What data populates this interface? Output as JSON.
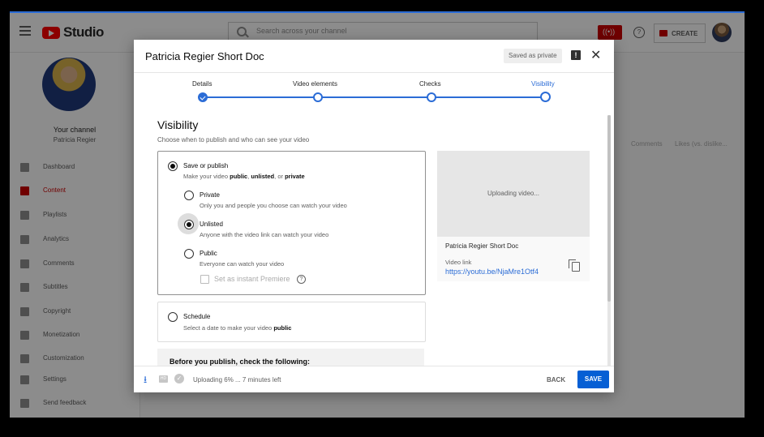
{
  "header": {
    "logo_text": "Studio",
    "search_placeholder": "Search across your channel",
    "create_label": "CREATE"
  },
  "sidebar": {
    "your_channel": "Your channel",
    "channel_name": "Patricia Regier",
    "items": [
      {
        "label": "Dashboard",
        "icon": "dashboard-icon"
      },
      {
        "label": "Content",
        "icon": "content-icon",
        "active": true
      },
      {
        "label": "Playlists",
        "icon": "playlists-icon"
      },
      {
        "label": "Analytics",
        "icon": "analytics-icon"
      },
      {
        "label": "Comments",
        "icon": "comments-icon"
      },
      {
        "label": "Subtitles",
        "icon": "subtitles-icon"
      },
      {
        "label": "Copyright",
        "icon": "copyright-icon"
      },
      {
        "label": "Monetization",
        "icon": "monetization-icon"
      },
      {
        "label": "Customization",
        "icon": "customization-icon"
      },
      {
        "label": "Settings",
        "icon": "settings-icon"
      },
      {
        "label": "Send feedback",
        "icon": "feedback-icon"
      }
    ]
  },
  "background": {
    "col_comments": "Comments",
    "col_likes": "Likes (vs. dislike..."
  },
  "dialog": {
    "title": "Patricia Regier Short Doc",
    "saved_badge": "Saved as private",
    "steps": [
      {
        "label": "Details",
        "state": "done"
      },
      {
        "label": "Video elements",
        "state": "pending"
      },
      {
        "label": "Checks",
        "state": "pending"
      },
      {
        "label": "Visibility",
        "state": "current"
      }
    ],
    "visibility_title": "Visibility",
    "visibility_sub": "Choose when to publish and who can see your video",
    "save_or_publish": {
      "label": "Save or publish",
      "desc_pre": "Make your video ",
      "desc_b1": "public",
      "desc_mid1": ", ",
      "desc_b2": "unlisted",
      "desc_mid2": ", or ",
      "desc_b3": "private"
    },
    "options": {
      "private_label": "Private",
      "private_desc": "Only you and people you choose can watch your video",
      "unlisted_label": "Unlisted",
      "unlisted_desc": "Anyone with the video link can watch your video",
      "public_label": "Public",
      "public_desc": "Everyone can watch your video",
      "premiere_label": "Set as instant Premiere",
      "selected": "Unlisted"
    },
    "schedule": {
      "label": "Schedule",
      "desc_pre": "Select a date to make your video ",
      "desc_b": "public"
    },
    "before_publish": "Before you publish, check the following:",
    "preview": {
      "uploading": "Uploading video...",
      "title": "Patricia Regier Short Doc",
      "link_label": "Video link",
      "link": "https://youtu.be/NjaMre1Otf4"
    },
    "footer": {
      "status": "Uploading 6% ... 7 minutes left",
      "back": "BACK",
      "save": "SAVE"
    }
  }
}
